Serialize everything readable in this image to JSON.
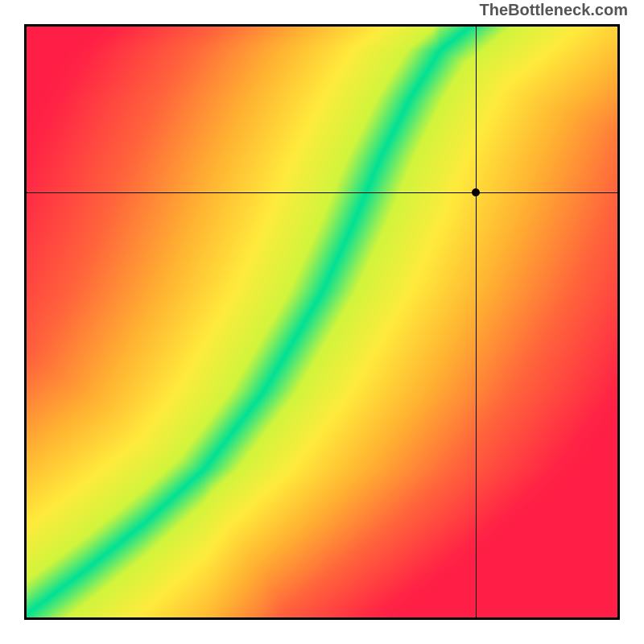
{
  "attribution": "TheBottleneck.com",
  "chart_data": {
    "type": "heatmap",
    "title": "",
    "xlabel": "",
    "ylabel": "",
    "xlim": [
      0,
      100
    ],
    "ylim": [
      0,
      100
    ],
    "crosshair": {
      "x": 76,
      "y": 72
    },
    "optimal_curve": [
      {
        "x": 2,
        "y": 2
      },
      {
        "x": 10,
        "y": 8
      },
      {
        "x": 20,
        "y": 16
      },
      {
        "x": 30,
        "y": 25
      },
      {
        "x": 40,
        "y": 38
      },
      {
        "x": 50,
        "y": 55
      },
      {
        "x": 55,
        "y": 66
      },
      {
        "x": 60,
        "y": 78
      },
      {
        "x": 65,
        "y": 88
      },
      {
        "x": 70,
        "y": 96
      },
      {
        "x": 75,
        "y": 100
      }
    ],
    "band_half_width_pct": 4,
    "description": "Heatmap shading from red (worst) through orange/yellow to green (optimal) along a diagonal-ish S-curve ridge; crosshair marks a specific (CPU, GPU) point off the optimal band in the yellow region."
  }
}
